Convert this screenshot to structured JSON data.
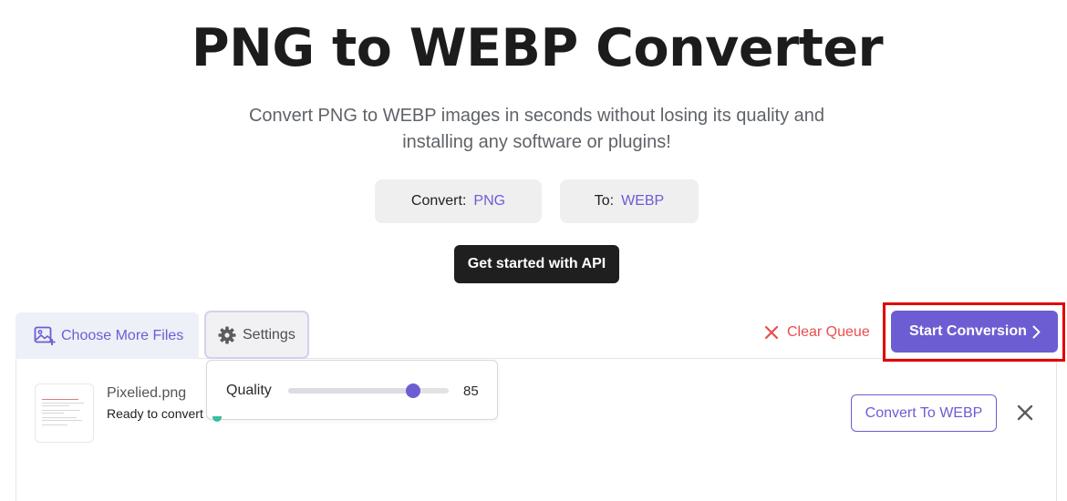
{
  "header": {
    "title": "PNG to WEBP Converter",
    "subtitle_line1": "Convert PNG to WEBP images in seconds without losing its quality and",
    "subtitle_line2": "installing any software or plugins!"
  },
  "format_selector": {
    "convert_label": "Convert:",
    "convert_value": "PNG",
    "to_label": "To:",
    "to_value": "WEBP"
  },
  "api_button_label": "Get started with API",
  "toolbar": {
    "choose_files_label": "Choose More Files",
    "settings_label": "Settings",
    "clear_queue_label": "Clear Queue",
    "start_conversion_label": "Start Conversion"
  },
  "settings": {
    "quality_label": "Quality",
    "quality_value": "85",
    "quality_fraction": 0.78
  },
  "file": {
    "name": "Pixelied.png",
    "status": "Ready to convert",
    "convert_label": "Convert To WEBP"
  },
  "colors": {
    "accent": "#6c5dd3",
    "danger": "#ea4d4d",
    "highlight": "#e00000",
    "dark_button": "#1f1f1f"
  },
  "icons": [
    "image-add-icon",
    "gear-icon",
    "close-icon",
    "chevron-right-icon",
    "remove-icon"
  ]
}
